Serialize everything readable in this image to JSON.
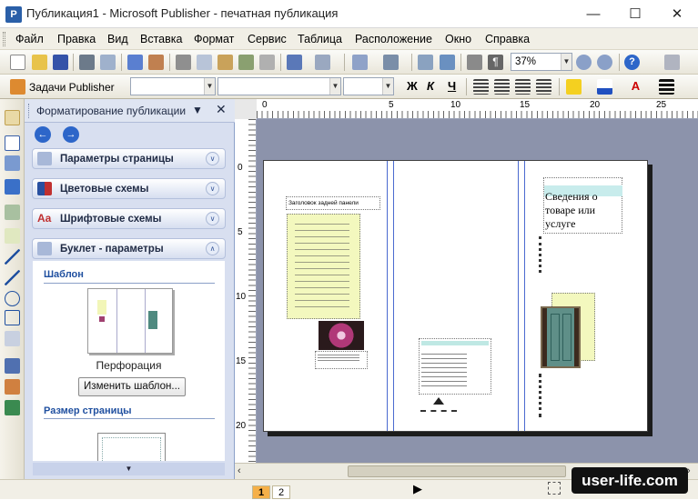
{
  "window": {
    "title": "Публикация1 - Microsoft Publisher - печатная публикация",
    "app_icon": "P"
  },
  "menu": [
    "Файл",
    "Правка",
    "Вид",
    "Вставка",
    "Формат",
    "Сервис",
    "Таблица",
    "Расположение",
    "Окно",
    "Справка"
  ],
  "toolbar": {
    "zoom": "37%",
    "task_label": "Задачи Publisher",
    "bold": "Ж",
    "italic": "К",
    "underline": "Ч"
  },
  "taskpane": {
    "title": "Форматирование публикации",
    "sections": [
      {
        "label": "Параметры страницы"
      },
      {
        "label": "Цветовые схемы"
      },
      {
        "label": "Шрифтовые схемы"
      },
      {
        "label": "Буклет - параметры"
      }
    ],
    "template_heading": "Шаблон",
    "template_name": "Перфорация",
    "change_template_button": "Изменить шаблон...",
    "page_size_heading": "Размер страницы"
  },
  "ruler": {
    "h_labels": [
      "0",
      "5",
      "10",
      "15",
      "20",
      "25"
    ],
    "v_labels": [
      "0",
      "5",
      "10",
      "15",
      "20"
    ]
  },
  "document": {
    "panel_heading": "Заголовок задней панели",
    "product_heading": "Сведения о товаре или услуге"
  },
  "pages": [
    "1",
    "2"
  ],
  "watermark": "user-life.com",
  "colors": {
    "accent": "#2d66c9",
    "workspace": "#8c93ab",
    "taskpane": "#d8dff0"
  }
}
